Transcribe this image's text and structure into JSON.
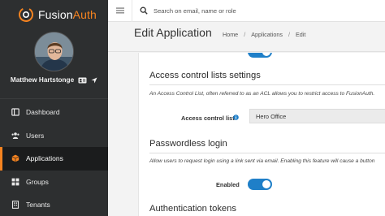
{
  "brand": {
    "name_prefix": "Fusion",
    "name_suffix": "Auth",
    "accent": "#f58320"
  },
  "user": {
    "name": "Matthew Hartstonge",
    "id_icon": "id-card-icon",
    "location_icon": "location-arrow-icon"
  },
  "sidebar": {
    "items": [
      {
        "label": "Dashboard",
        "icon": "dashboard-icon",
        "active": false
      },
      {
        "label": "Users",
        "icon": "users-icon",
        "active": false
      },
      {
        "label": "Applications",
        "icon": "cube-icon",
        "active": true
      },
      {
        "label": "Groups",
        "icon": "groups-icon",
        "active": false
      },
      {
        "label": "Tenants",
        "icon": "tenants-icon",
        "active": false
      }
    ]
  },
  "topbar": {
    "search_placeholder": "Search on email, name or role"
  },
  "header": {
    "title": "Edit Application",
    "breadcrumb": [
      "Home",
      "Applications",
      "Edit"
    ],
    "separator": "/"
  },
  "content": {
    "acl_section": {
      "title": "Access control lists settings",
      "description": "An Access Control List, often referred to as an ACL allows you to restrict access to FusionAuth.",
      "field_label": "Access control list",
      "selected_value": "Hero Office"
    },
    "passwordless_section": {
      "title": "Passwordless login",
      "description": "Allow users to request login using a link sent via email. Enabling this feature will cause a button",
      "field_label": "Enabled",
      "enabled": true
    },
    "auth_tokens_section": {
      "title": "Authentication tokens"
    }
  },
  "colors": {
    "toggle_on": "#1f7fc8",
    "sidebar_bg": "#2d2f30",
    "info_icon": "#1f7fc8"
  }
}
